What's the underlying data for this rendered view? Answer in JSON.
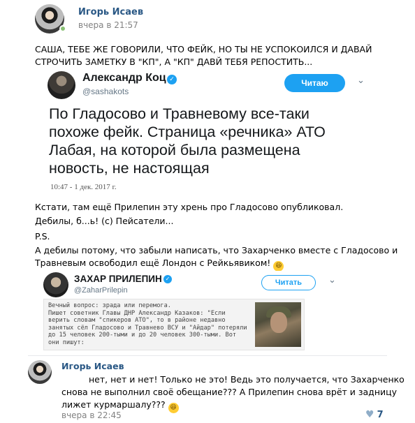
{
  "post": {
    "author": "Игорь Исаев",
    "time": "вчера в 21:57",
    "text_line1": "САША, ТЕБЕ ЖЕ ГОВОРИЛИ, ЧТО ФЕЙК, НО ТЫ НЕ УСПОКОИЛСЯ И ДАВАЙ",
    "text_line2": "СТРОЧИТЬ ЗАМЕТКУ В \"КП\", А \"КП\" ДАВЙ ТЕБЯ РЕПОСТИТЬ..."
  },
  "tweet1": {
    "name": "Александр Коц",
    "handle": "@sashakots",
    "follow_label": "Читаю",
    "chevron": "⌄",
    "verified_mark": "✓",
    "body": "По Гладосово и Травневому все-таки похоже фейк. Страница «речника» АТО Лабая, на которой была размещена новость, не настоящая",
    "date": "10:47 - 1 дек. 2017 г."
  },
  "post_body": {
    "line1": "Кстати, там ещё Прилепин эту хрень про Гладосово опубликовал.",
    "line2": "Дебилы, б...ь! (с) Пейсатели...",
    "line3": "P.S.",
    "line4": "А дебилы потому, что забыли написать, что Захарченко вместе с Гладосово и",
    "line5": "Травневым освободил ещё Лондон с Рейкьявиком!",
    "emoji": "😆"
  },
  "tweet2": {
    "name": "ЗАХАР ПРИЛЕПИН",
    "handle": "@ZaharPrilepin",
    "follow_label": "Читать",
    "chevron": "⌄",
    "verified_mark": "✓",
    "quote_lines": [
      "Вечный вопрос: зрада или перемога.",
      "Пишет советник Главы ДНР Александр Казаков: \"Если",
      "верить словам \"спикеров АТО\", то в районе недавно",
      "занятых сёл Гладосово и Травнево ВСУ и \"Айдар\" потеряли",
      "до 15 человек 200-тыми и до 20 человек 300-тыми. Вот",
      "они пишут:"
    ]
  },
  "comment": {
    "author": "Игорь Исаев",
    "line1": "нет, нет и нет! Только не это! Ведь это получается, что Захарченко",
    "line2": "снова не выполнил своё обещание??? А Прилепин снова врёт и задницу",
    "line3": "лижет курмаршалу???",
    "emoji": "😆",
    "time": "вчера в 22:45"
  },
  "likes": {
    "icon": "heart-icon",
    "heart": "♥",
    "count": "7"
  },
  "colors": {
    "author_link": "#2a5885",
    "twitter_blue": "#1da1f2"
  }
}
